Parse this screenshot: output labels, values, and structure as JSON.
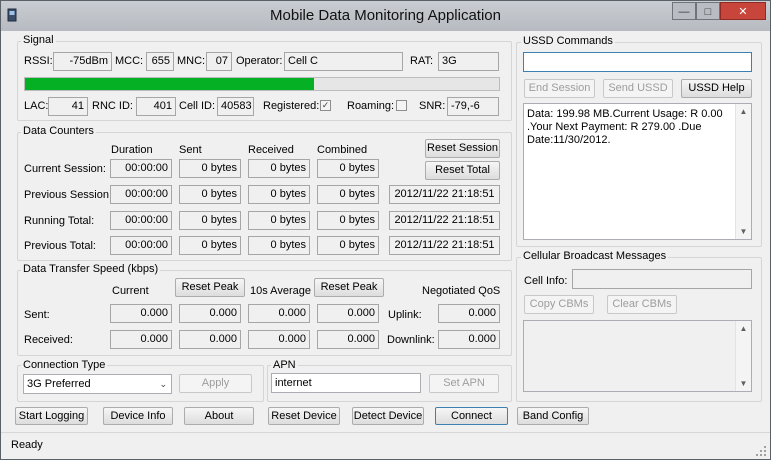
{
  "window": {
    "title": "Mobile Data Monitoring Application"
  },
  "signal": {
    "group": "Signal",
    "rssi_label": "RSSI:",
    "rssi": "-75dBm",
    "mcc_label": "MCC:",
    "mcc": "655",
    "mnc_label": "MNC:",
    "mnc": "07",
    "operator_label": "Operator:",
    "operator": "Cell C",
    "rat_label": "RAT:",
    "rat": "3G",
    "strength_fraction": 0.61,
    "lac_label": "LAC:",
    "lac": "41",
    "rnc_label": "RNC ID:",
    "rnc": "401",
    "cell_label": "Cell ID:",
    "cell": "40583",
    "registered_label": "Registered:",
    "registered": true,
    "roaming_label": "Roaming:",
    "roaming": false,
    "snr_label": "SNR:",
    "snr": "-79,-6"
  },
  "counters": {
    "group": "Data Counters",
    "col_duration": "Duration",
    "col_sent": "Sent",
    "col_received": "Received",
    "col_combined": "Combined",
    "reset_session": "Reset Session",
    "reset_total": "Reset Total",
    "rows": [
      {
        "label": "Current Session:",
        "duration": "00:00:00",
        "sent": "0 bytes",
        "received": "0 bytes",
        "combined": "0 bytes",
        "stamp": ""
      },
      {
        "label": "Previous Session:",
        "duration": "00:00:00",
        "sent": "0 bytes",
        "received": "0 bytes",
        "combined": "0 bytes",
        "stamp": "2012/11/22 21:18:51"
      },
      {
        "label": "Running Total:",
        "duration": "00:00:00",
        "sent": "0 bytes",
        "received": "0 bytes",
        "combined": "0 bytes",
        "stamp": "2012/11/22 21:18:51"
      },
      {
        "label": "Previous Total:",
        "duration": "00:00:00",
        "sent": "0 bytes",
        "received": "0 bytes",
        "combined": "0 bytes",
        "stamp": "2012/11/22 21:18:51"
      }
    ]
  },
  "speed": {
    "group": "Data Transfer Speed (kbps)",
    "current": "Current",
    "reset_peak": "Reset Peak",
    "avg": "10s Average",
    "qos": "Negotiated QoS",
    "sent_label": "Sent:",
    "received_label": "Received:",
    "uplink_label": "Uplink:",
    "downlink_label": "Downlink:",
    "sent": [
      "0.000",
      "0.000",
      "0.000",
      "0.000"
    ],
    "received": [
      "0.000",
      "0.000",
      "0.000",
      "0.000"
    ],
    "uplink": "0.000",
    "downlink": "0.000"
  },
  "connection": {
    "group": "Connection Type",
    "selected": "3G Preferred",
    "apply": "Apply"
  },
  "apn": {
    "group": "APN",
    "value": "internet",
    "set": "Set APN"
  },
  "ussd": {
    "group": "USSD Commands",
    "input": "",
    "end": "End Session",
    "send": "Send USSD",
    "help": "USSD Help",
    "response": "Data: 199.98 MB.Current Usage: R 0.00 .Your Next Payment: R 279.00 .Due Date:11/30/2012."
  },
  "cbm": {
    "group": "Cellular Broadcast Messages",
    "cell_info_label": "Cell Info:",
    "cell_info": "",
    "copy": "Copy CBMs",
    "clear": "Clear CBMs"
  },
  "toolbar": {
    "start_logging": "Start Logging",
    "device_info": "Device Info",
    "about": "About",
    "reset_device": "Reset Device",
    "detect_device": "Detect Device",
    "connect": "Connect",
    "band_config": "Band Config"
  },
  "status": "Ready",
  "colors": {
    "progress": "#06b025",
    "close": "#c7453a"
  }
}
